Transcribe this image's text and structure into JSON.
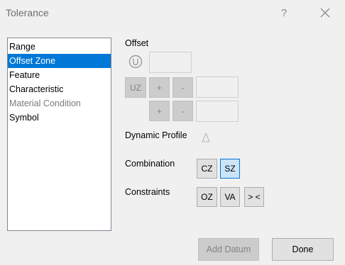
{
  "window": {
    "title": "Tolerance",
    "help_label": "?"
  },
  "category_list": [
    {
      "label": "Range",
      "state": "normal"
    },
    {
      "label": "Offset Zone",
      "state": "selected"
    },
    {
      "label": "Feature",
      "state": "normal"
    },
    {
      "label": "Characteristic",
      "state": "normal"
    },
    {
      "label": "Material Condition",
      "state": "disabled"
    },
    {
      "label": "Symbol",
      "state": "normal"
    }
  ],
  "offset": {
    "heading": "Offset",
    "uz_label": "UZ",
    "plus_label": "+",
    "minus_label": "-"
  },
  "dynamic_profile": {
    "label": "Dynamic Profile"
  },
  "combination": {
    "label": "Combination",
    "cz_label": "CZ",
    "sz_label": "SZ"
  },
  "constraints": {
    "label": "Constraints",
    "oz_label": "OZ",
    "va_label": "VA",
    "gt_lt_label": "> <"
  },
  "footer": {
    "add_datum_label": "Add Datum",
    "done_label": "Done"
  },
  "colors": {
    "selection": "#0078d7",
    "active_toggle": "#cce4f7"
  }
}
